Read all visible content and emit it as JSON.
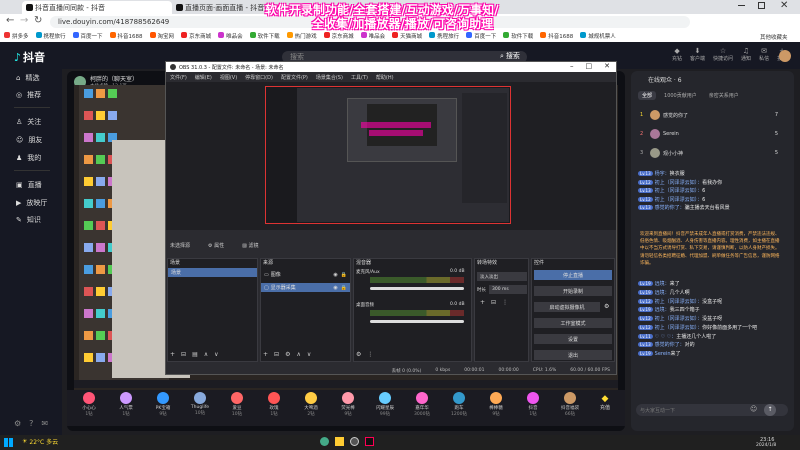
{
  "browser": {
    "tabs": [
      {
        "label": "抖音直播间同款 - 抖音"
      },
      {
        "label": "直播页面·画面直播 - 抖音搜索"
      }
    ],
    "url": "live.douyin.com/418788562649",
    "bookmarks": [
      "拼多多",
      "携程旅行",
      "百度一下",
      "抖音1688",
      "淘宝网",
      "京东商城",
      "唯品会",
      "软件下载",
      "热门游戏",
      "京东商城",
      "唯品会",
      "天猫商城",
      "携程旅行",
      "百度一下",
      "软件下载",
      "抖音1688",
      "城规机票人"
    ],
    "bookmarks_more": "其他收藏夹"
  },
  "overlay": {
    "line1": "软件开录制功能/全套搭建/互动游戏/万事知/",
    "line2": "全收集/加播放器/播放/可咨询助理"
  },
  "app": {
    "logo": "抖音",
    "search_placeholder": "搜索",
    "search_button": "搜索",
    "nav": [
      "精选",
      "推荐",
      "关注",
      "朋友",
      "我的",
      "直播",
      "放映厅",
      "知识"
    ],
    "header_icons": [
      "充钻",
      "客户端",
      "快捷访问",
      "通知",
      "私信",
      "投稿"
    ]
  },
  "stream": {
    "streamer_name": "柯胖的（聊天室）",
    "viewers": "本场点赞 · 12.1万",
    "gifts": [
      {
        "name": "小心心",
        "price": "1钻"
      },
      {
        "name": "人气票",
        "price": "1钻"
      },
      {
        "name": "PK宝箱",
        "price": "9钻"
      },
      {
        "name": "Thuglife",
        "price": "10钻"
      },
      {
        "name": "爱豆",
        "price": "10钻"
      },
      {
        "name": "玫瑰",
        "price": "1钻"
      },
      {
        "name": "大啤酒",
        "price": "2钻"
      },
      {
        "name": "荧光棒",
        "price": "9钻"
      },
      {
        "name": "闪耀星辰",
        "price": "99钻"
      },
      {
        "name": "嘉年华",
        "price": "3000钻"
      },
      {
        "name": "跑车",
        "price": "1200钻"
      },
      {
        "name": "棒棒糖",
        "price": "9钻"
      },
      {
        "name": "抖音",
        "price": "1钻"
      },
      {
        "name": "抖音福袋",
        "price": "66钻"
      }
    ],
    "more_label": "更多",
    "gift_more": "充值"
  },
  "obs": {
    "title": "OBS 31.0.3 - 配置文件: 未命名 - 场景: 未命名",
    "menu": [
      "文件(F)",
      "编辑(E)",
      "视图(V)",
      "停靠窗口(D)",
      "配置文件(P)",
      "场景集合(S)",
      "工具(T)",
      "帮助(H)"
    ],
    "no_source": "未选择源",
    "props": "属性",
    "filters": "滤镜",
    "panels": {
      "scenes": "场景",
      "sources": "来源",
      "mixer": "混音器",
      "transitions": "转场特效",
      "controls": "控件"
    },
    "scene_items": [
      "场景"
    ],
    "source_items": [
      "图像",
      "显示器采集"
    ],
    "mixer_tracks": [
      {
        "name": "麦克风/Aux",
        "db": "0.0 dB"
      },
      {
        "name": "桌面音频",
        "db": "0.0 dB"
      }
    ],
    "transition": "淡入淡出",
    "duration_label": "时长",
    "duration": "300 ms",
    "controls": [
      "停止直播",
      "开始录制",
      "启动虚拟摄像机",
      "工作室模式",
      "设置",
      "退出"
    ],
    "status": {
      "dropped": "丢帧 0 (0.0%)",
      "bitrate": "0 kbps",
      "live": "00:00:01",
      "rec": "00:00:00",
      "cpu": "CPU: 1.6%",
      "fps": "60.00 / 60.00 FPS"
    }
  },
  "chat": {
    "title": "在线观众 · 6",
    "tabs": [
      "全部",
      "1000贡献用户",
      "亲密关系用户"
    ],
    "ranks": [
      {
        "rank": "1",
        "name": "感觉的你了",
        "score": "7"
      },
      {
        "rank": "2",
        "name": "Serein",
        "score": "5"
      },
      {
        "rank": "3",
        "name": "观小小神",
        "score": "5"
      }
    ],
    "messages": [
      {
        "lv": "Lv.13",
        "user": "杨宇：",
        "text": "换衣服"
      },
      {
        "lv": "Lv.12",
        "user": "初上（冈泽漂云如）：",
        "text": "看我办你"
      },
      {
        "lv": "Lv.13",
        "user": "初上（冈泽漂云如）：",
        "text": "6"
      },
      {
        "lv": "Lv.12",
        "user": "初上（冈泽漂云如）：",
        "text": "6"
      },
      {
        "lv": "Lv.13",
        "user": "感觉的你了：",
        "text": "骗主播去天台看风景"
      }
    ],
    "notice": "欢迎来到直播间！抖音严禁未成年人直播或打赏消费，严禁违法违规、低俗色情、吸烟酗酒、人身伤害等直播内容。理性消费，如主播在直播中以不当方式诱导打赏、私下交易，请谨慎判断，以防人身财产损失。请勿轻信各类招聘征婚、代理加盟、刷单做任务等广告信息，谨防网络诈骗。",
    "messages2": [
      {
        "lv": "Lv.19",
        "user": "远境：",
        "text": "来了"
      },
      {
        "lv": "Lv.19",
        "user": "远境：",
        "text": "几个人啊"
      },
      {
        "lv": "Lv.12",
        "user": "初上（冈泽漂云如）：",
        "text": "没盒子呢"
      },
      {
        "lv": "Lv.19",
        "user": "远境：",
        "text": "我三四个箱子"
      },
      {
        "lv": "Lv.12",
        "user": "初上（冈泽漂云如）：",
        "text": "没盆子呀"
      },
      {
        "lv": "Lv.12",
        "user": "初上（冈泽漂云如）：",
        "text": "你好像前面多用了一个吧"
      },
      {
        "lv": "Lv.11",
        "user": "♡ ♡ ♡：",
        "text": "主播还几个人啦了"
      },
      {
        "lv": "Lv.13",
        "user": "感觉的你了：",
        "text": "对的"
      },
      {
        "lv": "Lv.19",
        "user": "Serein",
        "text": "来了"
      }
    ],
    "input_placeholder": "与大家互动一下",
    "send": "发送"
  },
  "taskbar": {
    "weather": "22°C 多云",
    "time": "23:16",
    "date": "2024/1/8"
  }
}
